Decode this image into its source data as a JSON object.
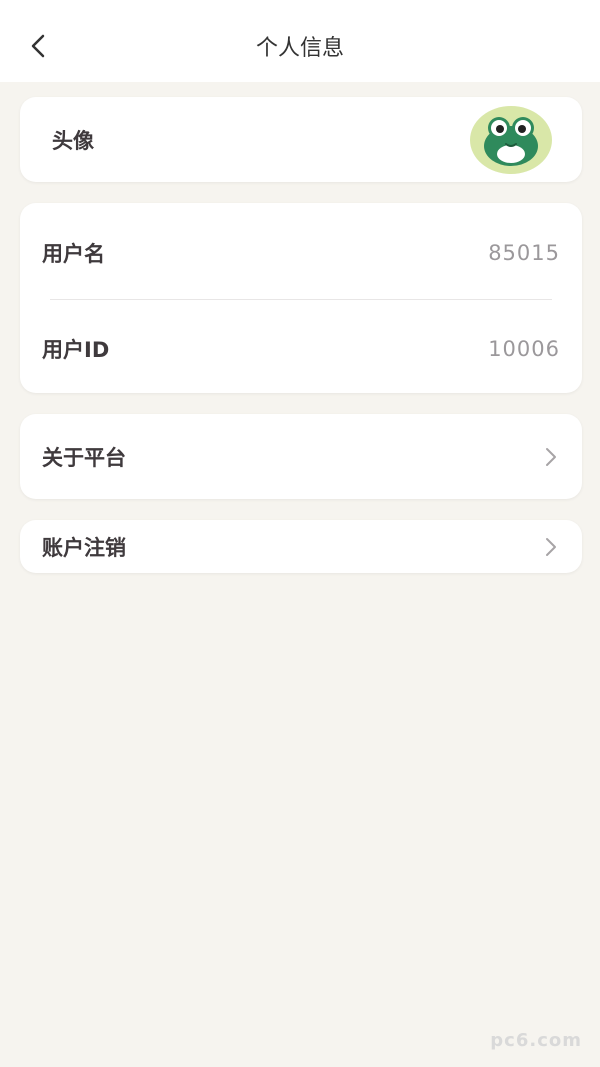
{
  "header": {
    "title": "个人信息",
    "back_icon": "chevron-left-icon"
  },
  "avatar_card": {
    "label": "头像",
    "avatar_icon": "frog-avatar"
  },
  "account_card": {
    "rows": [
      {
        "label": "用户名",
        "value": "85015"
      },
      {
        "label": "用户ID",
        "value": "10006"
      }
    ]
  },
  "about": {
    "label": "关于平台",
    "icon": "chevron-right-icon"
  },
  "cancel": {
    "label": "账户注销",
    "icon": "chevron-right-icon"
  },
  "watermark": "pc6.com",
  "colors": {
    "background": "#f6f4ef",
    "card": "#ffffff",
    "label": "#3f3a3d",
    "value": "#9b989b",
    "avatar_bg": "#d9e7a8",
    "frog": "#2f8a5c"
  }
}
